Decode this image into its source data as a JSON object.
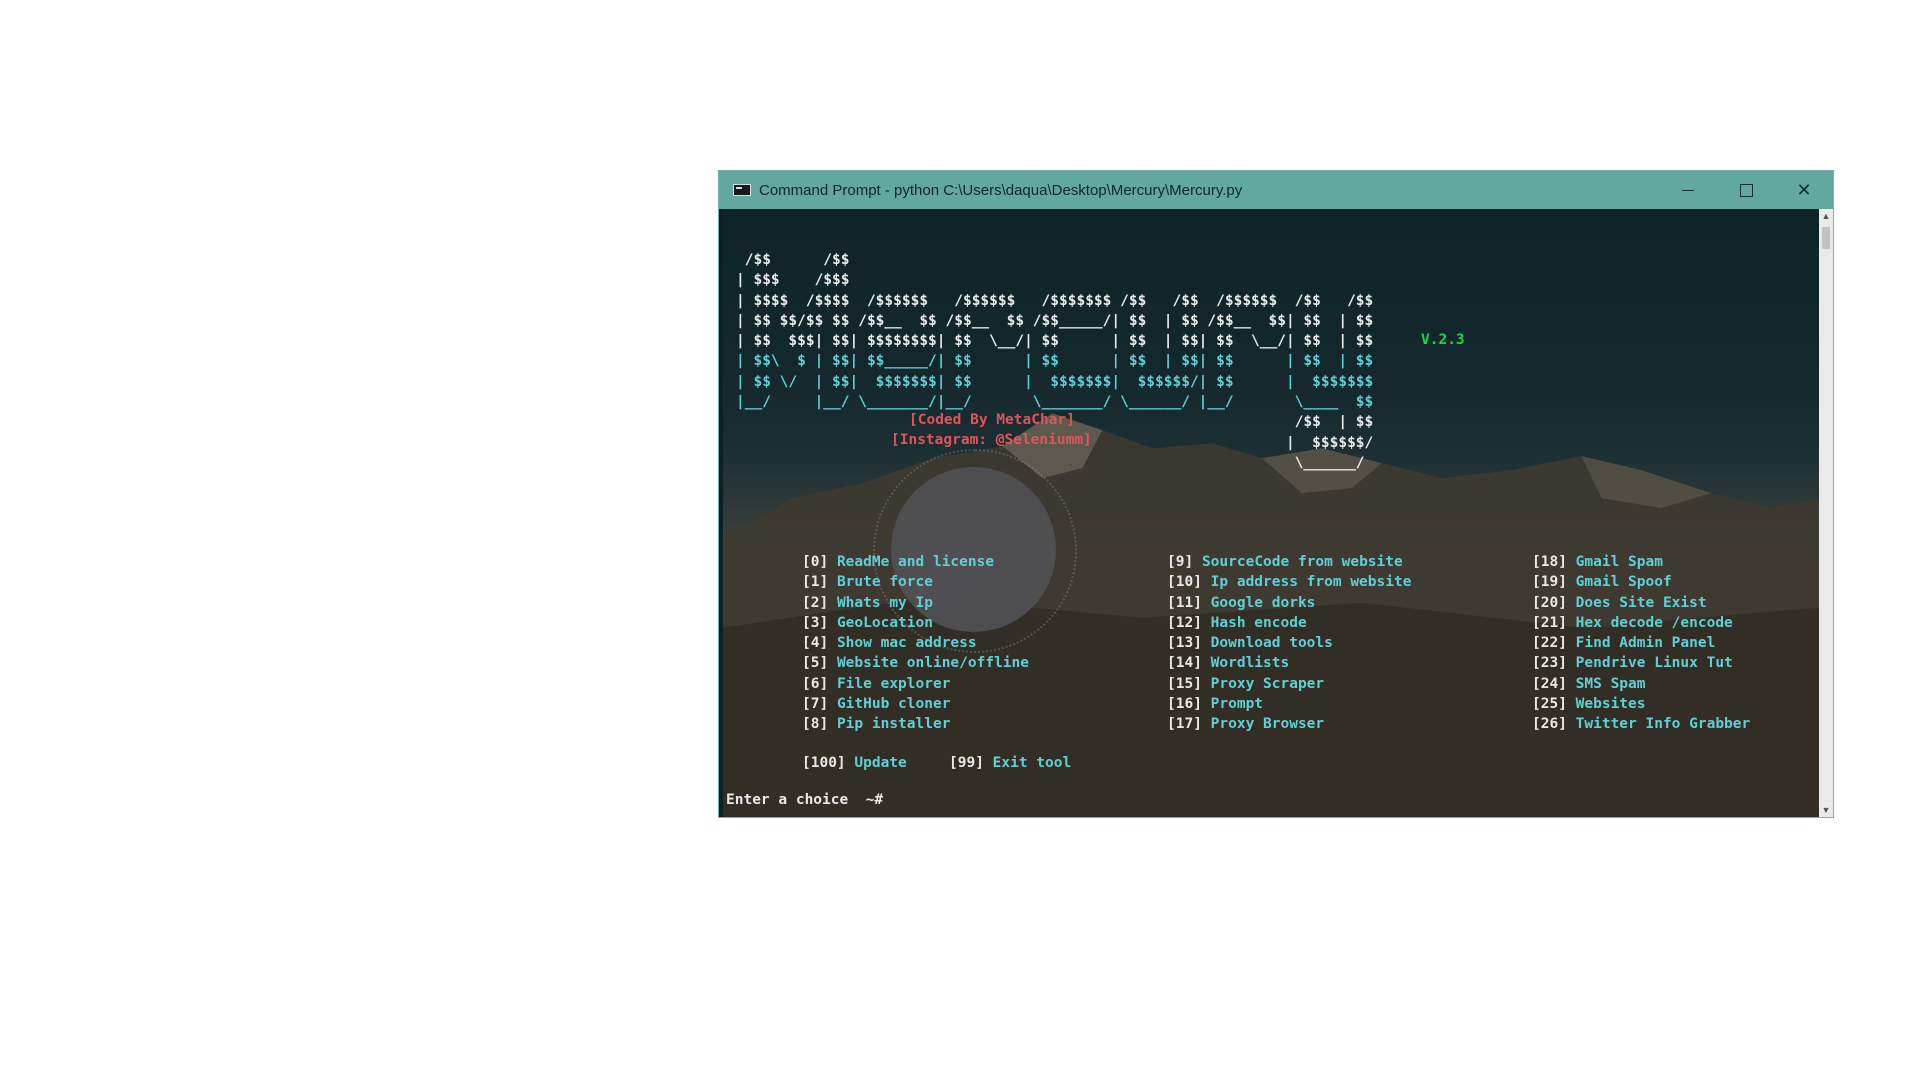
{
  "window": {
    "title": "Command Prompt - python  C:\\Users\\daqua\\Desktop\\Mercury\\Mercury.py",
    "controls": {
      "minimize": "—",
      "maximize": "☐",
      "close": "✕"
    },
    "icon": "cmd-icon"
  },
  "banner": {
    "lines_white": [
      " /$$      /$$",
      "| $$$    /$$$",
      "| $$$$  /$$$$  /$$$$$$   /$$$$$$   /$$$$$$$ /$$   /$$  /$$$$$$  /$$   /$$",
      "| $$ $$/$$ $$ /$$__  $$ /$$__  $$ /$$_____/| $$  | $$ /$$__  $$| $$  | $$",
      "| $$  $$$| $$| $$$$$$$$| $$  \\__/| $$      | $$  | $$| $$  \\__/| $$  | $$"
    ],
    "lines_cyan": [
      "| $$\\  $ | $$| $$_____/| $$      | $$      | $$  | $$| $$      | $$  | $$",
      "| $$ \\/  | $$|  $$$$$$$| $$      |  $$$$$$$|  $$$$$$/| $$      |  $$$$$$$",
      "|__/     |__/ \\_______/|__/       \\_______/ \\______/ |__/       \\____  $$"
    ],
    "lines_tail": [
      "                                                                /$$  | $$",
      "                                                               |  $$$$$$/",
      "                                                                \\______/"
    ],
    "version": "V.2.3",
    "coded_by": "[Coded By MetaChar]",
    "instagram": "[Instagram: @Seleniumm]"
  },
  "menu": {
    "col1": [
      {
        "num": "[0]",
        "label": "ReadMe and license"
      },
      {
        "num": "[1]",
        "label": "Brute force"
      },
      {
        "num": "[2]",
        "label": "Whats my Ip"
      },
      {
        "num": "[3]",
        "label": "GeoLocation"
      },
      {
        "num": "[4]",
        "label": "Show mac address"
      },
      {
        "num": "[5]",
        "label": "Website online/offline"
      },
      {
        "num": "[6]",
        "label": "File explorer"
      },
      {
        "num": "[7]",
        "label": "GitHub cloner"
      },
      {
        "num": "[8]",
        "label": "Pip installer"
      }
    ],
    "col2": [
      {
        "num": "[9]",
        "label": "SourceCode from website"
      },
      {
        "num": "[10]",
        "label": "Ip address from website"
      },
      {
        "num": "[11]",
        "label": "Google dorks"
      },
      {
        "num": "[12]",
        "label": "Hash encode"
      },
      {
        "num": "[13]",
        "label": "Download tools"
      },
      {
        "num": "[14]",
        "label": "Wordlists"
      },
      {
        "num": "[15]",
        "label": "Proxy Scraper"
      },
      {
        "num": "[16]",
        "label": "Prompt"
      },
      {
        "num": "[17]",
        "label": "Proxy Browser"
      }
    ],
    "col3": [
      {
        "num": "[18]",
        "label": "Gmail Spam"
      },
      {
        "num": "[19]",
        "label": "Gmail Spoof"
      },
      {
        "num": "[20]",
        "label": "Does Site Exist"
      },
      {
        "num": "[21]",
        "label": "Hex decode /encode"
      },
      {
        "num": "[22]",
        "label": "Find Admin Panel"
      },
      {
        "num": "[23]",
        "label": "Pendrive Linux Tut"
      },
      {
        "num": "[24]",
        "label": "SMS Spam"
      },
      {
        "num": "[25]",
        "label": "Websites"
      },
      {
        "num": "[26]",
        "label": "Twitter Info Grabber"
      }
    ],
    "update": {
      "num": "[100]",
      "label": "Update"
    },
    "exit": {
      "num": "[99]",
      "label": "Exit tool"
    }
  },
  "prompt": "Enter a choice  ~#",
  "colors": {
    "titlebar": "#62a7a0",
    "menu_label": "#5fd0d6",
    "credit": "#e0555a",
    "version": "#1fd64a"
  }
}
